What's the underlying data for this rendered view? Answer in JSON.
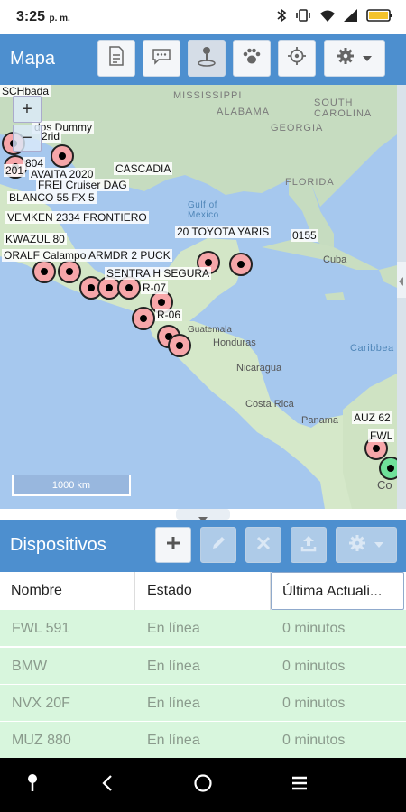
{
  "status": {
    "time": "3:25",
    "ampm": "p. m."
  },
  "map_panel": {
    "title": "Mapa",
    "zoom_in": "+",
    "zoom_out": "−",
    "scale": "1000 km",
    "places": {
      "mississippi": "MISSISSIPPI",
      "alabama": "ALABAMA",
      "georgia": "GEORGIA",
      "south_carolina": "SOUTH CAROLINA",
      "florida": "FLORIDA",
      "gulf": "Gulf of Mexico",
      "cuba": "Cuba",
      "honduras": "Honduras",
      "nicaragua": "Nicaragua",
      "guatemala": "Guatemala",
      "costa_rica": "Costa Rica",
      "panama": "Panama",
      "caribbean": "Caribbea",
      "colombia_part": "Co"
    },
    "device_labels": [
      "SCHbada",
      "dos Dummy",
      "2rid",
      "804",
      "201",
      "AVAITA 2020",
      "CASCADIA",
      "FREI Cruiser DAG",
      "BLANCO 55 FX 5",
      "VEMKEN 2334 FRONTIERO",
      "KWAZUL 80",
      "20 TOYOTA YARIS",
      "0155",
      "ORALF Calampo ARMDR 2 PUCK",
      "SENTRA H SEGURA",
      "R-07",
      "R-06",
      "AUZ 62",
      "FWL"
    ]
  },
  "devices_panel": {
    "title": "Dispositivos",
    "columns": [
      "Nombre",
      "Estado",
      "Última Actuali..."
    ],
    "rows": [
      {
        "name": "FWL 591",
        "status": "En línea",
        "updated": "0 minutos"
      },
      {
        "name": "BMW",
        "status": "En línea",
        "updated": "0 minutos"
      },
      {
        "name": "NVX 20F",
        "status": "En línea",
        "updated": "0 minutos"
      },
      {
        "name": "MUZ 880",
        "status": "En línea",
        "updated": "0 minutos"
      }
    ]
  },
  "colors": {
    "toolbar": "#4d8fcf",
    "online_row": "#d8f6dd",
    "marker": "#f6a6a9",
    "marker_green": "#6fe09a"
  }
}
